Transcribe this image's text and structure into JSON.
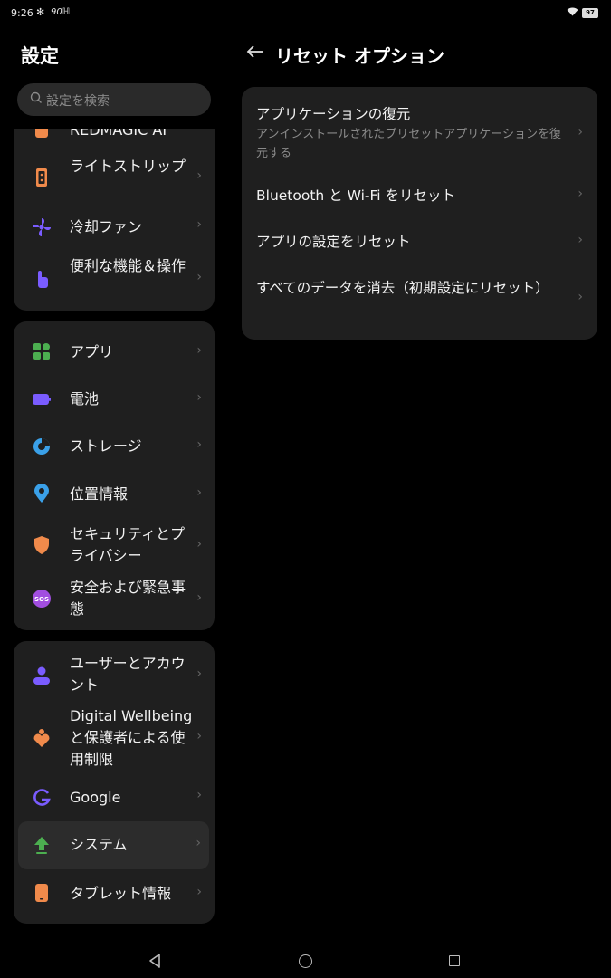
{
  "status": {
    "time": "9:26",
    "refresh": "90",
    "battery": "97"
  },
  "left": {
    "title": "設定",
    "search_placeholder": "設定を検索",
    "group1": [
      {
        "label": "REDMAGIC AI",
        "icon": "redmagic-ai-icon"
      },
      {
        "label": "ライトストリップ",
        "icon": "light-strip-icon"
      },
      {
        "label": "冷却ファン",
        "icon": "cooling-fan-icon"
      },
      {
        "label": "便利な機能＆操作",
        "icon": "gesture-hand-icon"
      }
    ],
    "group2": [
      {
        "label": "アプリ",
        "icon": "apps-grid-icon"
      },
      {
        "label": "電池",
        "icon": "battery-icon"
      },
      {
        "label": "ストレージ",
        "icon": "storage-pie-icon"
      },
      {
        "label": "位置情報",
        "icon": "location-pin-icon"
      },
      {
        "label": "セキュリティとプライバシー",
        "icon": "shield-icon"
      },
      {
        "label": "安全および緊急事態",
        "icon": "sos-icon"
      }
    ],
    "group3": [
      {
        "label": "ユーザーとアカウント",
        "icon": "user-icon"
      },
      {
        "label": "Digital Wellbeing と保護者による使用制限",
        "icon": "wellbeing-heart-icon"
      },
      {
        "label": "Google",
        "icon": "google-g-icon"
      },
      {
        "label": "システム",
        "icon": "system-update-icon"
      },
      {
        "label": "タブレット情報",
        "icon": "tablet-icon"
      }
    ],
    "selected": "システム"
  },
  "right": {
    "title": "リセット オプション",
    "options": [
      {
        "title": "アプリケーションの復元",
        "subtitle": "アンインストールされたプリセットアプリケーションを復元する"
      },
      {
        "title": "Bluetooth と Wi-Fi をリセット"
      },
      {
        "title": "アプリの設定をリセット"
      },
      {
        "title": "すべてのデータを消去（初期設定にリセット）"
      }
    ]
  },
  "colors": {
    "background": "#000000",
    "card": "#1f1f1f",
    "selected_row": "#2c2c2c",
    "secondary_text": "#8a8a8a",
    "accent_green": "#4caf50",
    "accent_orange": "#f08a4b",
    "accent_purple": "#7a5cff"
  }
}
